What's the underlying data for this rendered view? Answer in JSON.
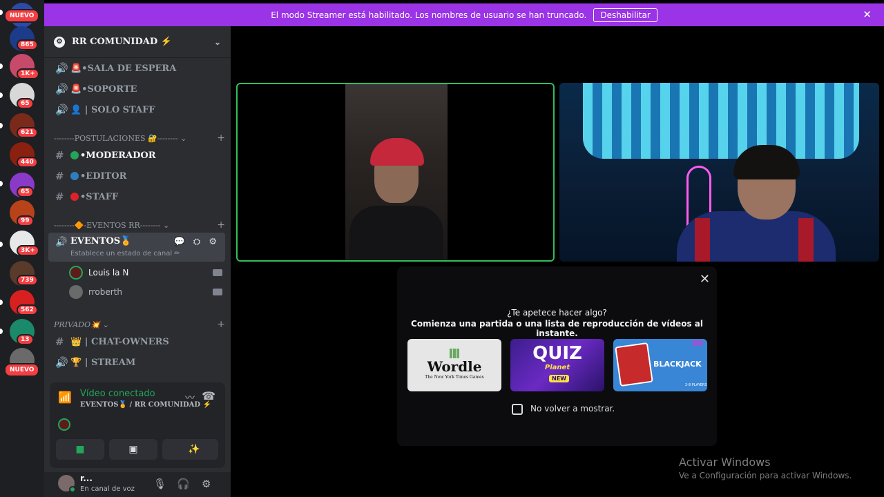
{
  "banner": {
    "message": "El modo Streamer está habilitado. Los nombres de usuario se han truncado.",
    "button": "Deshabilitar",
    "close": "✕"
  },
  "rail": {
    "badges": [
      "NUEVO",
      "865",
      "1K+",
      "65",
      "621",
      "440",
      "65",
      "99",
      "3K+",
      "739",
      "562",
      "13",
      "NUEVO"
    ]
  },
  "server": {
    "name": "RR COMUNIDAD ⚡",
    "chevron": "⌄"
  },
  "channels": [
    {
      "glyph": "🔊",
      "name": "🚨•SALA DE ESPERA"
    },
    {
      "glyph": "🔊",
      "name": "🚨•SOPORTE"
    },
    {
      "glyph": "🔊",
      "name": "👤 | SOLO STAFF"
    }
  ],
  "categories": [
    {
      "label": "--------POSTULACIONES 🔐-------- ⌄",
      "plus": "+"
    },
    {
      "label": "--------🔶-EVENTOS RR-------- ⌄",
      "plus": "+"
    },
    {
      "label": "PRIVADO💥 ⌄",
      "plus": "+"
    }
  ],
  "postulaciones": [
    {
      "glyph": "#",
      "dot": "#23a55a",
      "name": "•MODERADOR"
    },
    {
      "glyph": "#",
      "dot": "#2f7dbd",
      "name": "•EDITOR"
    },
    {
      "glyph": "#",
      "dot": "#e0202a",
      "name": "•STAFF"
    }
  ],
  "events_channel": {
    "name": "EVENTOS🏅",
    "status": "Establece un estado de canal ✏",
    "icons": "💬 ⛭ ⚙"
  },
  "voice_users": [
    {
      "name": "Louis la N",
      "color": "#5c1c1c"
    },
    {
      "name": "rroberth",
      "color": "#6a6a6a"
    }
  ],
  "private_channels": [
    {
      "glyph": "#",
      "name": "👑 | CHAT-OWNERS"
    },
    {
      "glyph": "🔊",
      "name": "🏆 | STREAM"
    }
  ],
  "voice_panel": {
    "status": "Vídeo conectado",
    "location": "EVENTOS🏅 / RR COMUNIDAD ⚡"
  },
  "user": {
    "name": "r...",
    "status": "En canal de voz"
  },
  "activity": {
    "question": "¿Te apetece hacer algo?",
    "subtitle": "Comienza una partida o una lista de reproducción de vídeos al instante.",
    "cards": {
      "wordle": {
        "title": "Wordle",
        "sub": "The New York Times Games"
      },
      "quiz": {
        "title": "QUIZ",
        "planet": "Planet",
        "badge": "NEW"
      },
      "blackjack": {
        "title": "BLACKJACK",
        "players": "2-8 PLAYERS"
      }
    },
    "checkbox_label": "No volver a mostrar."
  },
  "watermark": {
    "title": "Activar Windows",
    "subtitle": "Ve a Configuración para activar Windows."
  },
  "colors": {
    "banner": "#9b33e6",
    "speaking": "#2fbf5a",
    "online": "#23a55a",
    "badge": "#f23f43"
  }
}
